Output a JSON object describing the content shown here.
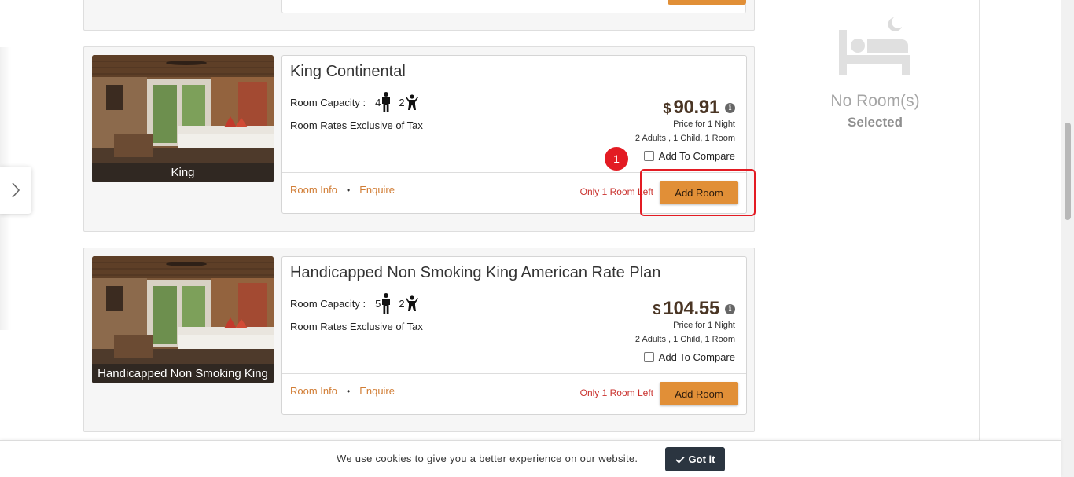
{
  "rooms": [
    {
      "image_caption": "King",
      "title": "King Continental",
      "capacity_label": "Room Capacity :",
      "adults": "4",
      "children": "2",
      "rate_note": "Room Rates Exclusive of Tax",
      "currency": "$",
      "price": "90.91",
      "per_night": "Price for 1 Night",
      "occupancy": "2 Adults , 1 Child, 1 Room",
      "compare_label": "Add To Compare",
      "room_info": "Room Info",
      "enquire": "Enquire",
      "availability": "Only 1 Room Left",
      "add_room": "Add Room"
    },
    {
      "image_caption": "Handicapped Non Smoking King",
      "title": "Handicapped Non Smoking King American Rate Plan",
      "capacity_label": "Room Capacity :",
      "adults": "5",
      "children": "2",
      "rate_note": "Room Rates Exclusive of Tax",
      "currency": "$",
      "price": "104.55",
      "per_night": "Price for 1 Night",
      "occupancy": "2 Adults , 1 Child, 1 Room",
      "compare_label": "Add To Compare",
      "room_info": "Room Info",
      "enquire": "Enquire",
      "availability": "Only 1 Room Left",
      "add_room": "Add Room"
    }
  ],
  "annotation": {
    "badge": "1",
    "color": "#e31b23"
  },
  "summary": {
    "title": "No Room(s)",
    "subtitle": "Selected",
    "icon": "bed-moon-icon"
  },
  "cookie": {
    "message": "We use cookies to give you a better experience on our website.",
    "button": "Got it"
  },
  "colors": {
    "accent": "#e18f37",
    "link": "#d17d35",
    "warning": "#c9302c",
    "price": "#4a3524",
    "dark_button": "#2b3540"
  }
}
